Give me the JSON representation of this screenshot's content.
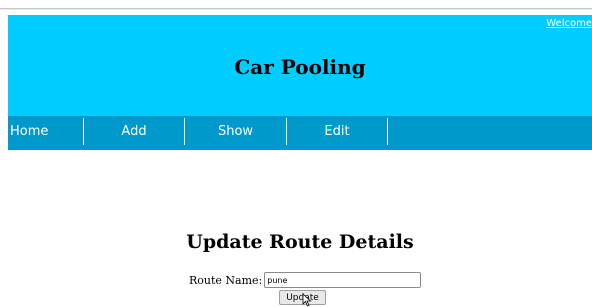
{
  "header": {
    "welcome_link": "Welcome",
    "site_title": "Car Pooling",
    "background_color": "#00ccff"
  },
  "nav": {
    "background_color": "#0099cc",
    "items": [
      {
        "label": "Home"
      },
      {
        "label": "Add"
      },
      {
        "label": "Show"
      },
      {
        "label": "Edit"
      }
    ]
  },
  "form": {
    "title": "Update Route Details",
    "route_name_label": "Route Name:",
    "route_name_value": "pune",
    "update_button": "Update"
  }
}
